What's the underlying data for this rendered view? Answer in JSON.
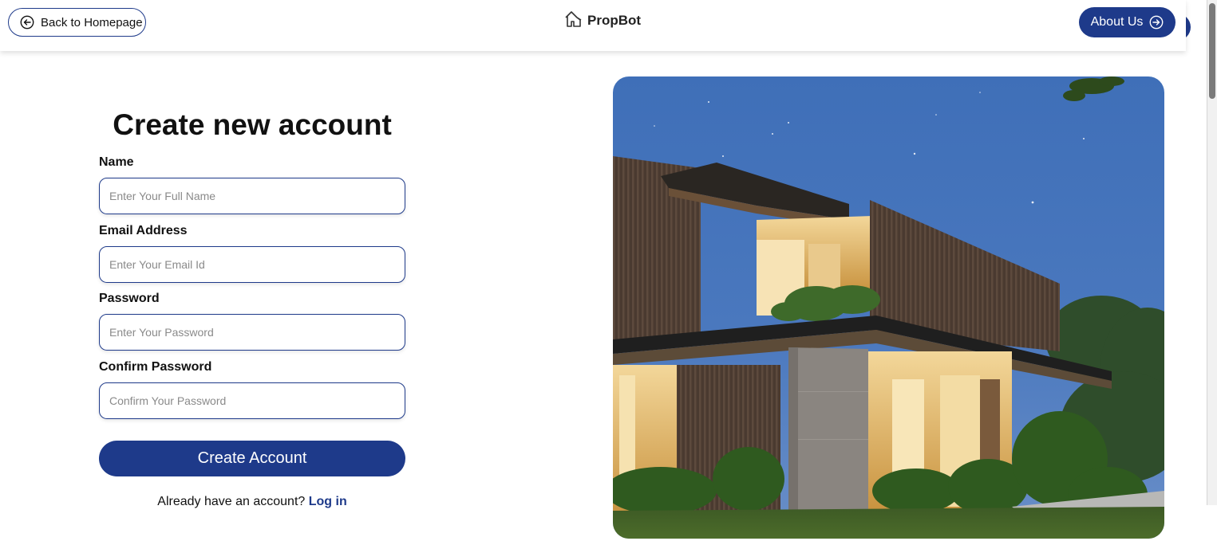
{
  "header": {
    "back_label": "Back to Homepage",
    "brand": "PropBot",
    "about_label": "About Us"
  },
  "form": {
    "title": "Create new account",
    "fields": [
      {
        "label": "Name",
        "placeholder": "Enter Your Full Name"
      },
      {
        "label": "Email Address",
        "placeholder": "Enter Your Email Id"
      },
      {
        "label": "Password",
        "placeholder": "Enter Your Password"
      },
      {
        "label": "Confirm Password",
        "placeholder": "Confirm Your Password"
      }
    ],
    "submit_label": "Create Account",
    "login_prompt": "Already have an account?",
    "login_link": "Log in"
  },
  "icons": {
    "back": "arrow-left-circle-icon",
    "brand": "house-icon",
    "about": "arrow-right-circle-icon"
  },
  "colors": {
    "primary": "#1e3a8a"
  }
}
